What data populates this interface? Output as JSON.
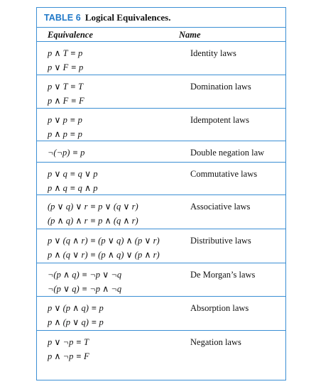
{
  "table": {
    "number_label": "TABLE 6",
    "title": "Logical Equivalences.",
    "col_equivalence": "Equivalence",
    "col_name": "Name",
    "rows": [
      {
        "equivalences": [
          "p ∧ T ≡ p",
          "p ∨ F ≡ p"
        ],
        "name": "Identity laws"
      },
      {
        "equivalences": [
          "p ∨ T ≡ T",
          "p ∧ F ≡ F"
        ],
        "name": "Domination laws"
      },
      {
        "equivalences": [
          "p ∨ p ≡ p",
          "p ∧ p ≡ p"
        ],
        "name": "Idempotent laws"
      },
      {
        "equivalences": [
          "¬(¬p) ≡ p"
        ],
        "name": "Double negation law"
      },
      {
        "equivalences": [
          "p ∨ q ≡ q ∨ p",
          "p ∧ q ≡ q ∧ p"
        ],
        "name": "Commutative laws"
      },
      {
        "equivalences": [
          "(p ∨ q) ∨ r ≡ p ∨ (q ∨ r)",
          "(p ∧ q) ∧ r ≡ p ∧ (q ∧ r)"
        ],
        "name": "Associative laws"
      },
      {
        "equivalences": [
          "p ∨ (q ∧ r) ≡ (p ∨ q) ∧ (p ∨ r)",
          "p ∧ (q ∨ r) ≡ (p ∧ q) ∨ (p ∧ r)"
        ],
        "name": "Distributive laws"
      },
      {
        "equivalences": [
          "¬(p ∧ q) ≡ ¬p ∨ ¬q",
          "¬(p ∨ q) ≡ ¬p ∧ ¬q"
        ],
        "name": "De Morgan’s laws"
      },
      {
        "equivalences": [
          "p ∨ (p ∧ q) ≡ p",
          "p ∧ (p ∨ q) ≡ p"
        ],
        "name": "Absorption laws"
      },
      {
        "equivalences": [
          "p ∨ ¬p ≡ T",
          "p ∧ ¬p ≡ F"
        ],
        "name": "Negation laws"
      }
    ]
  }
}
